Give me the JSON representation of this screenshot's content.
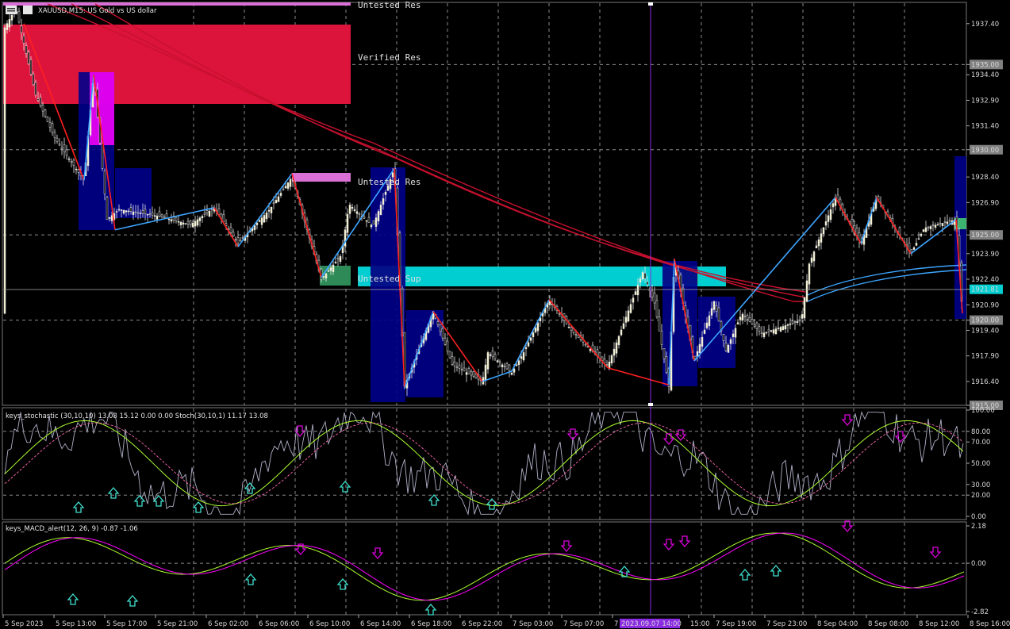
{
  "header": {
    "title": "XAUUSD,M15: US Gold vs US dollar"
  },
  "zones": {
    "verified_res": "Verified Res",
    "untested_res_top": "Untested Res",
    "untested_res_mid": "Untested Res",
    "untested_sup": "Untested Sup"
  },
  "price_axis": {
    "ticks": [
      "1937.40",
      "1935.00",
      "1934.40",
      "1932.90",
      "1931.40",
      "1930.00",
      "1928.40",
      "1926.90",
      "1925.00",
      "1923.90",
      "1922.40",
      "1921.81",
      "1920.90",
      "1920.00",
      "1919.40",
      "1917.90",
      "1916.40",
      "1915.00"
    ],
    "current_price": "1921.81",
    "range": [
      1915.0,
      1938.6
    ]
  },
  "stochastic": {
    "label": "keys_stochastic (30,10,10) 13.08 15.12 0.00 0.00 Stoch(30,10,1) 11.17 13.08",
    "ticks": [
      "100.00",
      "80.00",
      "70.00",
      "50.00",
      "30.00",
      "20.00",
      "0.00"
    ]
  },
  "macd": {
    "label": "keys_MACD_alert(12, 26, 9) -0.87 -1.06",
    "ticks": [
      "2.18",
      "0.00",
      "-2.82"
    ]
  },
  "time_axis": {
    "labels": [
      "5 Sep 2023",
      "5 Sep 13:00",
      "5 Sep 17:00",
      "5 Sep 21:00",
      "6 Sep 02:00",
      "6 Sep 06:00",
      "6 Sep 10:00",
      "6 Sep 14:00",
      "6 Sep 18:00",
      "6 Sep 22:00",
      "7 Sep 03:00",
      "7 Sep 07:00",
      "7",
      "15:00",
      "7 Sep 19:00",
      "7 Sep 23:00",
      "8 Sep 04:00",
      "8 Sep 08:00",
      "8 Sep 12:00",
      "8 Sep 16:00"
    ],
    "crosshair_time": "2023.09.07 14:00"
  },
  "colors": {
    "bull": "#f5f0c8",
    "bear": "#ffffff",
    "up_leg": "#3da5ff",
    "down_leg": "#ff2020",
    "res": "#dc143c",
    "sup": "#00ced1",
    "ma": "#c8102e",
    "ma2": "#3da5ff"
  }
}
